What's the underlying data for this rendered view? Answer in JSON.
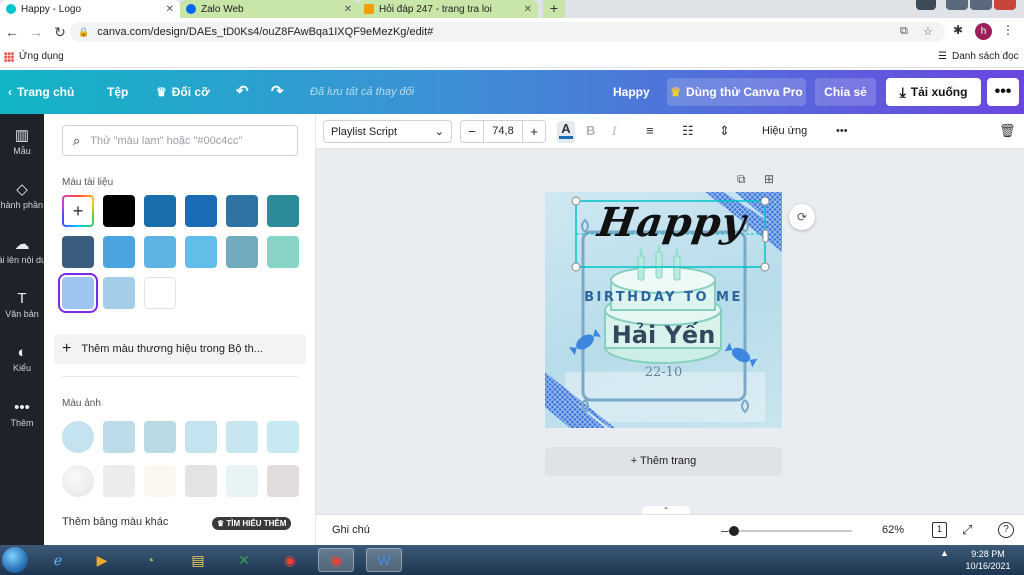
{
  "browser": {
    "tabs": [
      {
        "title": "Happy - Logo",
        "favicon_color": "#00c4cc"
      },
      {
        "title": "Zalo Web",
        "favicon_color": "#0068ff"
      },
      {
        "title": "Hỏi đáp 247 - trang tra loi",
        "favicon_color": "#f2a000"
      }
    ],
    "new_tab_icon": "plus-icon",
    "url": "canva.com/design/DAEs_tD0Ks4/ouZ8FAwBqa1IXQF9eMezKg/edit#",
    "profile_initial": "h",
    "bookmarks": {
      "apps_label": "Ứng dụng",
      "reading_list_label": "Danh sách đọc"
    }
  },
  "canva_header": {
    "home_label": "Trang chủ",
    "file_label": "Tệp",
    "resize_label": "Đổi cỡ",
    "saved_status": "Đã lưu tất cả thay đổi",
    "design_title": "Happy",
    "try_pro_label": "Dùng thử Canva Pro",
    "share_label": "Chia sẻ",
    "download_label": "Tải xuống"
  },
  "rail": {
    "items": [
      {
        "label": "Mẫu",
        "icon": "template-icon"
      },
      {
        "label": "Thành phần",
        "icon": "elements-icon"
      },
      {
        "label": "Tải lên nội dung ...",
        "icon": "upload-icon"
      },
      {
        "label": "Văn bản",
        "icon": "text-icon"
      },
      {
        "label": "Kiểu",
        "icon": "styles-icon"
      },
      {
        "label": "Thêm",
        "icon": "more-icon"
      }
    ]
  },
  "color_panel": {
    "search_placeholder": "Thử \"màu lam\" hoặc \"#00c4cc\"",
    "document_colors_title": "Màu tài liệu",
    "document_colors": [
      "#000000",
      "#1a6fab",
      "#1b6bb5",
      "#2f73a4",
      "#2c8a99",
      "#3a5d80",
      "#4ba3e0",
      "#5eb3e4",
      "#62bde9",
      "#72aabf",
      "#88d5c8",
      "#9ec4f0",
      "#a3cde8",
      "#ffffff"
    ],
    "selected_color": "#9ec4f0",
    "add_brand_label": "Thêm màu thương hiệu trong Bộ th...",
    "photo_colors_title": "Màu ảnh",
    "photo_colors": [
      "#c4e2ef",
      "#bcdcea",
      "#bad9e3",
      "#c2e3ef",
      "#c7e6ef",
      "#c6e9f2",
      "#e8e8e8",
      "#ececec",
      "#fbf8f1",
      "#e4e2e3",
      "#e8f3f5",
      "#e2dbdc"
    ],
    "more_colors_label": "Thêm bảng màu khác",
    "learn_more_label": "TÌM HIỂU THÊM"
  },
  "toolbar": {
    "font_name": "Playlist Script",
    "font_size": "74,8",
    "size_minus": "−",
    "size_plus": "+",
    "effects_label": "Hiệu ứng"
  },
  "design": {
    "happy_text": "Happy",
    "birthday_text": "BIRTHDAY TO ME",
    "name_text": "Hải Yến",
    "date_text": "22-10"
  },
  "workspace": {
    "add_page_label": "+ Thêm trang"
  },
  "status": {
    "notes_label": "Ghi chú",
    "zoom": "62%",
    "page_count": "1",
    "zoom_level_fraction": 0.05
  },
  "taskbar": {
    "time": "9:28 PM",
    "date": "10/16/2021"
  }
}
